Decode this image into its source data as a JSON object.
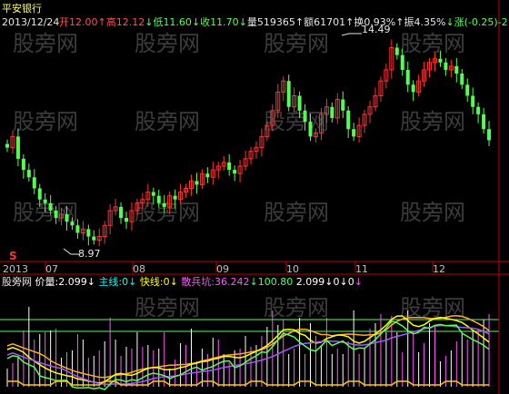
{
  "header": {
    "stock_name": "平安银行",
    "date": "2013/12/24",
    "open_label": "开",
    "open": "12.00",
    "high_label": "高",
    "high": "12.12",
    "low_label": "低",
    "low": "11.60",
    "close_label": "收",
    "close": "11.70",
    "volume_label": "量",
    "volume": "519365",
    "amount_label": "额",
    "amount": "61701",
    "turnover_label": "换",
    "turnover": "0.93%",
    "amplitude_label": "振",
    "amplitude": "4.35%",
    "change_label": "涨",
    "change": "(-0.25)-2"
  },
  "price_chart": {
    "peak_label": "14.49",
    "trough_label": "8.97",
    "signal_marker": "S",
    "time_axis": [
      "2013",
      "07",
      "08",
      "09",
      "10",
      "11",
      "12"
    ]
  },
  "indicator": {
    "name": "股旁网",
    "items": [
      {
        "label": "价量:",
        "value": "2.099",
        "color": "#ffffff"
      },
      {
        "label": "主线:",
        "value": "0",
        "color": "#00ffff"
      },
      {
        "label": "快线:",
        "value": "0",
        "color": "#ffff00"
      },
      {
        "label": "散兵坑:",
        "value": "36.242",
        "color": "#ff00ff"
      },
      {
        "label": "",
        "value": "100.80",
        "color": "#00ff00"
      },
      {
        "label": "",
        "value": "2.099",
        "color": "#ffffff"
      },
      {
        "label": "",
        "value": "0",
        "color": "#ffffff"
      },
      {
        "label": "",
        "value": "0",
        "color": "#ffffff"
      }
    ]
  },
  "watermark": "股旁网",
  "colors": {
    "up": "#ff3232",
    "down": "#54ff54",
    "background": "#000000",
    "axis": "#c00000",
    "ma": "#ffff00"
  },
  "chart_data": {
    "type": "candlestick",
    "x_periods": [
      "2013-06",
      "2013-07",
      "2013-08",
      "2013-09",
      "2013-10",
      "2013-11",
      "2013-12"
    ],
    "ylim": [
      8.5,
      14.8
    ],
    "annotated_high": 14.49,
    "annotated_low": 8.97,
    "close_series": [
      11.5,
      11.8,
      11.2,
      10.9,
      10.7,
      10.4,
      10.1,
      10.0,
      9.8,
      9.6,
      9.7,
      9.5,
      9.4,
      9.2,
      9.3,
      9.1,
      9.0,
      9.1,
      9.4,
      9.8,
      9.9,
      9.6,
      9.5,
      9.8,
      10.0,
      10.1,
      10.3,
      10.2,
      10.0,
      9.9,
      10.2,
      10.1,
      10.3,
      10.4,
      10.6,
      10.5,
      10.8,
      10.7,
      10.9,
      11.0,
      11.1,
      10.9,
      10.8,
      11.0,
      11.2,
      11.4,
      11.5,
      11.8,
      12.1,
      12.5,
      13.0,
      13.3,
      12.6,
      12.9,
      12.5,
      12.2,
      11.8,
      11.9,
      12.4,
      12.6,
      12.3,
      12.8,
      12.5,
      12.0,
      11.8,
      12.1,
      12.4,
      12.6,
      12.9,
      13.3,
      13.6,
      14.2,
      14.0,
      13.6,
      13.2,
      13.0,
      13.3,
      13.6,
      13.8,
      13.9,
      13.8,
      13.6,
      13.7,
      13.5,
      13.2,
      12.9,
      12.6,
      12.4,
      12.0,
      11.7
    ]
  }
}
